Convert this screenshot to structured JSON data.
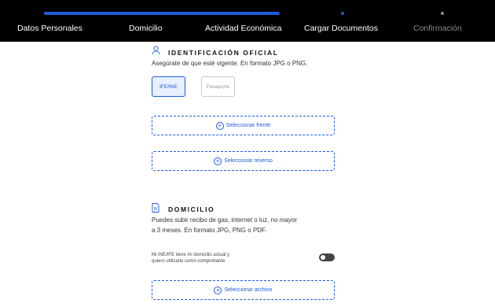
{
  "progress": {
    "completed_fraction": 0.79
  },
  "steps": [
    {
      "label": "Datos Personales"
    },
    {
      "label": "Domicilio"
    },
    {
      "label": "Actividad Económica"
    },
    {
      "label": "Cargar Documentos"
    },
    {
      "label": "Confirmación"
    }
  ],
  "identificacion": {
    "title": "IDENTIFICACIÓN OFICIAL",
    "description": "Asegúrate de que esté vigente. En formato JPG o PNG.",
    "options": [
      {
        "label": "IFE/INE",
        "selected": true
      },
      {
        "label": "Pasaporte",
        "selected": false
      }
    ],
    "upload_front": "Seleccionar frente",
    "upload_back": "Seleccionar reverso"
  },
  "domicilio": {
    "title": "DOMICILIO",
    "description_line1": "Puedes subir recibo de gas, internet o luz, no mayor",
    "description_line2": "a 3 meses. En formato JPG, PNG o PDF.",
    "toggle_label_line1": "Mi INE/IFE tiene mi domicilio actual y",
    "toggle_label_line2": "quiero utilizarlo como comprobante",
    "toggle_on": false,
    "upload_file": "Seleccionar archivo"
  },
  "colors": {
    "accent": "#1e5bd6",
    "topbar": "#000000"
  },
  "icons": {
    "identificacion": "user-icon",
    "domicilio": "document-icon",
    "upload": "plus-circle-icon"
  }
}
